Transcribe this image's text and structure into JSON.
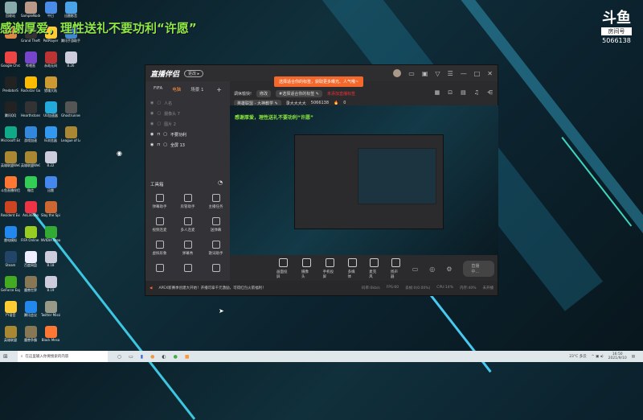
{
  "overlay_text": "感谢厚爱，理性送礼不要功利“许愿”",
  "douyu": {
    "logo": "斗鱼",
    "room_label": "房间号",
    "room_id": "5066138"
  },
  "desktop_icons": [
    {
      "label": "回收站",
      "color": "#8aa"
    },
    {
      "label": "SampleNode",
      "color": "#b98"
    },
    {
      "label": "中日",
      "color": "#4b8be8"
    },
    {
      "label": "迅雷影音",
      "color": "#4aa3e8"
    },
    {
      "label": "",
      "color": "#d84"
    },
    {
      "label": "Grand Theft Auto V",
      "color": "#333"
    },
    {
      "label": "PotPlayer",
      "color": "#fc3"
    },
    {
      "label": "腾讯手游助手",
      "color": "#48c"
    },
    {
      "label": "Google Chrome",
      "color": "#e44"
    },
    {
      "label": "哔哩直",
      "color": "#74c"
    },
    {
      "label": "永劫无间",
      "color": "#b33"
    },
    {
      "label": "8.26",
      "color": "#ccd"
    },
    {
      "label": "PredatorS",
      "color": "#222"
    },
    {
      "label": "Rockstar Games",
      "color": "#fb0"
    },
    {
      "label": "猎魂大陆",
      "color": "#c93"
    },
    {
      "label": "",
      "color": "transparent"
    },
    {
      "label": "腾讯QQ",
      "color": "#222"
    },
    {
      "label": "Hearthstone Deck Track",
      "color": "#333"
    },
    {
      "label": "UU加速器",
      "color": "#2ad"
    },
    {
      "label": "Ghostrunner",
      "color": "#555"
    },
    {
      "label": "Microsoft Edge",
      "color": "#1a8"
    },
    {
      "label": "游戏加速",
      "color": "#38d"
    },
    {
      "label": "IE浏览器",
      "color": "#39e"
    },
    {
      "label": "League of Legends",
      "color": "#a83"
    },
    {
      "label": "英雄联盟WeGame版",
      "color": "#a83"
    },
    {
      "label": "英雄联盟WeGame版",
      "color": "#a83"
    },
    {
      "label": "8.22",
      "color": "#ccd"
    },
    {
      "label": "",
      "color": "transparent"
    },
    {
      "label": "斗鱼直播伴侣",
      "color": "#f73"
    },
    {
      "label": "微信",
      "color": "#3c5"
    },
    {
      "label": "迅雷",
      "color": "#48e"
    },
    {
      "label": "",
      "color": "transparent"
    },
    {
      "label": "Resident Evil 5",
      "color": "#c42"
    },
    {
      "label": "AnLiVideo",
      "color": "#e34"
    },
    {
      "label": "Slay the Spire",
      "color": "#c63"
    },
    {
      "label": "",
      "color": "transparent"
    },
    {
      "label": "雷电模拟",
      "color": "#28e"
    },
    {
      "label": "FIFA Online 4",
      "color": "#9c2"
    },
    {
      "label": "NVIDIA Broadcast",
      "color": "#3a3"
    },
    {
      "label": "",
      "color": "transparent"
    },
    {
      "label": "Steam",
      "color": "#246"
    },
    {
      "label": "百度网盘",
      "color": "#eef"
    },
    {
      "label": "8.18",
      "color": "#ccd"
    },
    {
      "label": "",
      "color": "transparent"
    },
    {
      "label": "GeForce Experience",
      "color": "#4a2"
    },
    {
      "label": "魔兽世界",
      "color": "#875"
    },
    {
      "label": "8.19",
      "color": "#ccd"
    },
    {
      "label": "",
      "color": "transparent"
    },
    {
      "label": "YY语音",
      "color": "#fc3"
    },
    {
      "label": "腾讯会议",
      "color": "#28e"
    },
    {
      "label": "Twitter Mission",
      "color": "#998"
    },
    {
      "label": "",
      "color": "transparent"
    },
    {
      "label": "英雄联盟",
      "color": "#a83"
    },
    {
      "label": "魔兽争霸",
      "color": "#875"
    },
    {
      "label": "Black Mesa",
      "color": "#f73"
    },
    {
      "label": "",
      "color": "transparent"
    }
  ],
  "app": {
    "brand": "直播伴侣",
    "badge": "更改 ▸",
    "scene_tabs": [
      "FIFA",
      "电脑",
      "场景 1"
    ],
    "add_scene": "+",
    "layers": [
      {
        "name": "人名",
        "visible": false
      },
      {
        "name": "摄像头 7",
        "visible": false
      },
      {
        "name": "图片 2",
        "visible": false
      },
      {
        "name": "不要功利",
        "visible": true
      },
      {
        "name": "全屏 13",
        "visible": true
      }
    ],
    "toolbox_title": "工具箱",
    "tools": [
      "弹幕助手",
      "房管助手",
      "主播任务",
      "视频连麦",
      "多人连麦",
      "送弹幕",
      "虚拟形象",
      "弹幕秀",
      "歌词助手",
      "",
      "",
      ""
    ],
    "header": {
      "title": "调休愉快!",
      "edit": "修改",
      "tag": "#选择适合你的标签 ✎",
      "tag_warning": "未添加直播标签",
      "tooltip": "选择适合你的标签，获取更多曝光、人气哦~",
      "category": "英雄联盟 - 大神教学 ✎",
      "nickname": "录大大大大",
      "room_id": "5066138",
      "popularity": "0"
    },
    "preview_overlay": "感谢厚爱，理性送礼不要功利“许愿”",
    "controls": [
      "画面投屏",
      "摄像头",
      "手机投屏",
      "多媒体",
      "麦克风",
      "扬声器"
    ],
    "live_button": "直播中...",
    "notice": "APEX新赛季创建大开始！开播可拿千元激励，可得红包火箭福利！",
    "stats": [
      "码率:0kb/s",
      "FPS:60",
      "丢帧:0(0.00%)",
      "CPU:14%",
      "内存:40%",
      "未开播"
    ]
  },
  "taskbar": {
    "search_placeholder": "在这里输入你要搜索的内容",
    "weather": "23°C 多云",
    "time": "16:50",
    "date": "2021/9/10"
  }
}
